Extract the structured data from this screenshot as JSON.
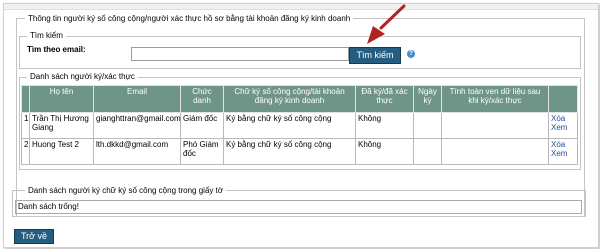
{
  "panel": {
    "legend": "Thông tin người ký số công cộng/người xác thực hồ sơ bằng tài khoản đăng ký kinh doanh"
  },
  "search": {
    "legend": "Tìm kiếm",
    "email_label": "Tìm theo email:",
    "email_value": "",
    "button_label": "Tìm kiếm",
    "help_glyph": "?"
  },
  "signers": {
    "legend": "Danh sách người ký/xác thực",
    "columns": [
      "Họ tên",
      "Email",
      "Chức danh",
      "Chữ ký số công cộng/tài khoản đăng ký kinh doanh",
      "Đã ký/đã xác thực",
      "Ngày ký",
      "Tính toàn vẹn dữ liệu sau khi ký/xác thực"
    ],
    "rows": [
      {
        "no": "1",
        "name": "Trần Thị Hương Giang",
        "email": "gianghttran@gmail.com",
        "title": "Giám đốc",
        "method": "Ký bằng chữ ký số công cộng",
        "signed": "Không",
        "date": "",
        "integrity": "",
        "delete": "Xóa",
        "view": "Xem"
      },
      {
        "no": "2",
        "name": "Huong Test 2",
        "email": "lth.dkkd@gmail.com",
        "title": "Phó Giám đốc",
        "method": "Ký bằng chữ ký số công cộng",
        "signed": "Không",
        "date": "",
        "integrity": "",
        "delete": "Xóa",
        "view": "Xem"
      }
    ]
  },
  "in_document": {
    "legend": "Danh sách người ký chữ ký số công cộng trong giấy tờ",
    "empty_text": "Danh sách trống!"
  },
  "back_button_label": "Trở về",
  "colors": {
    "header_bg": "#6f9488",
    "button_bg": "#245d80",
    "arrow": "#b22222",
    "link": "#1c4f9a"
  }
}
